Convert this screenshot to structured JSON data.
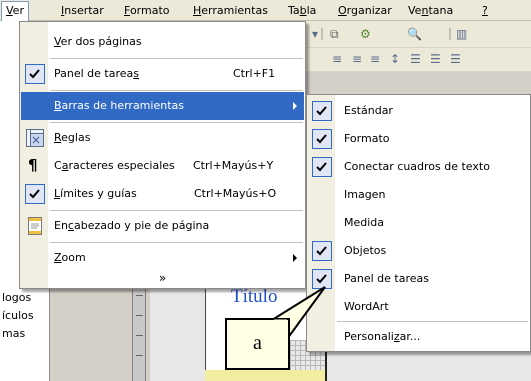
{
  "menubar": {
    "items": [
      {
        "key": "V",
        "rest": "er",
        "active": true
      },
      {
        "key": "I",
        "rest": "nsertar",
        "active": false
      },
      {
        "key": "F",
        "rest": "ormato",
        "active": false
      },
      {
        "key": "H",
        "rest": "erramientas",
        "active": false
      },
      {
        "pre": "Ta",
        "key": "b",
        "rest": "la",
        "active": false
      },
      {
        "key": "O",
        "rest": "rganizar",
        "active": false
      },
      {
        "pre": "Ve",
        "key": "n",
        "rest": "tana",
        "active": false
      },
      {
        "key": "?",
        "rest": "",
        "active": false
      }
    ]
  },
  "view_menu": {
    "items": [
      {
        "pre": "",
        "key": "V",
        "rest": "er dos páginas",
        "shortcut": "",
        "icon": "",
        "checked": false,
        "submenu": false,
        "highlighted": false
      },
      {
        "pre": "Panel de tarea",
        "key": "s",
        "rest": "",
        "shortcut": "Ctrl+F1",
        "icon": "",
        "checked": true,
        "submenu": false,
        "highlighted": false
      },
      {
        "pre": "",
        "key": "B",
        "rest": "arras de herramientas",
        "shortcut": "",
        "icon": "",
        "checked": false,
        "submenu": true,
        "highlighted": true
      },
      {
        "pre": "",
        "key": "R",
        "rest": "eglas",
        "shortcut": "",
        "icon": "rulers-icon",
        "checked": false,
        "submenu": false,
        "highlighted": false
      },
      {
        "pre": "C",
        "key": "a",
        "rest": "racteres especiales",
        "shortcut": "Ctrl+Mayús+Y",
        "icon": "pilcrow-icon",
        "checked": false,
        "submenu": false,
        "highlighted": false
      },
      {
        "pre": "",
        "key": "L",
        "rest": "ímites y guías",
        "shortcut": "Ctrl+Mayús+O",
        "icon": "",
        "checked": true,
        "submenu": false,
        "highlighted": false
      },
      {
        "pre": "En",
        "key": "c",
        "rest": "abezado y pie de página",
        "shortcut": "",
        "icon": "header-footer-icon",
        "checked": false,
        "submenu": false,
        "highlighted": false
      },
      {
        "pre": "",
        "key": "Z",
        "rest": "oom",
        "shortcut": "",
        "icon": "",
        "checked": false,
        "submenu": true,
        "highlighted": false
      }
    ],
    "expand_glyph": "»"
  },
  "toolbars_submenu": {
    "items": [
      {
        "pre": "Estándar",
        "key": "",
        "rest": "",
        "checked": true
      },
      {
        "pre": "Formato",
        "key": "",
        "rest": "",
        "checked": true
      },
      {
        "pre": "Conectar cuadros de texto",
        "key": "",
        "rest": "",
        "checked": true
      },
      {
        "pre": "Imagen",
        "key": "",
        "rest": "",
        "checked": false
      },
      {
        "pre": "Medida",
        "key": "",
        "rest": "",
        "checked": false
      },
      {
        "pre": "Objetos",
        "key": "",
        "rest": "",
        "checked": true
      },
      {
        "pre": "Panel de tareas",
        "key": "",
        "rest": "",
        "checked": true
      },
      {
        "pre": "WordArt",
        "key": "",
        "rest": "",
        "checked": false
      },
      {
        "pre": "Personali",
        "key": "z",
        "rest": "ar...",
        "checked": false
      }
    ]
  },
  "left_pane": {
    "items": [
      "logos",
      "ículos",
      "mas"
    ]
  },
  "document": {
    "title": "Título"
  },
  "callout": {
    "label": "a"
  },
  "colors": {
    "highlight": "#316ac5",
    "check_bg": "#e1e6f6",
    "gutter": "#f1efe2",
    "title_blue": "#2050d0",
    "callout_bg": "#ffffe6"
  }
}
